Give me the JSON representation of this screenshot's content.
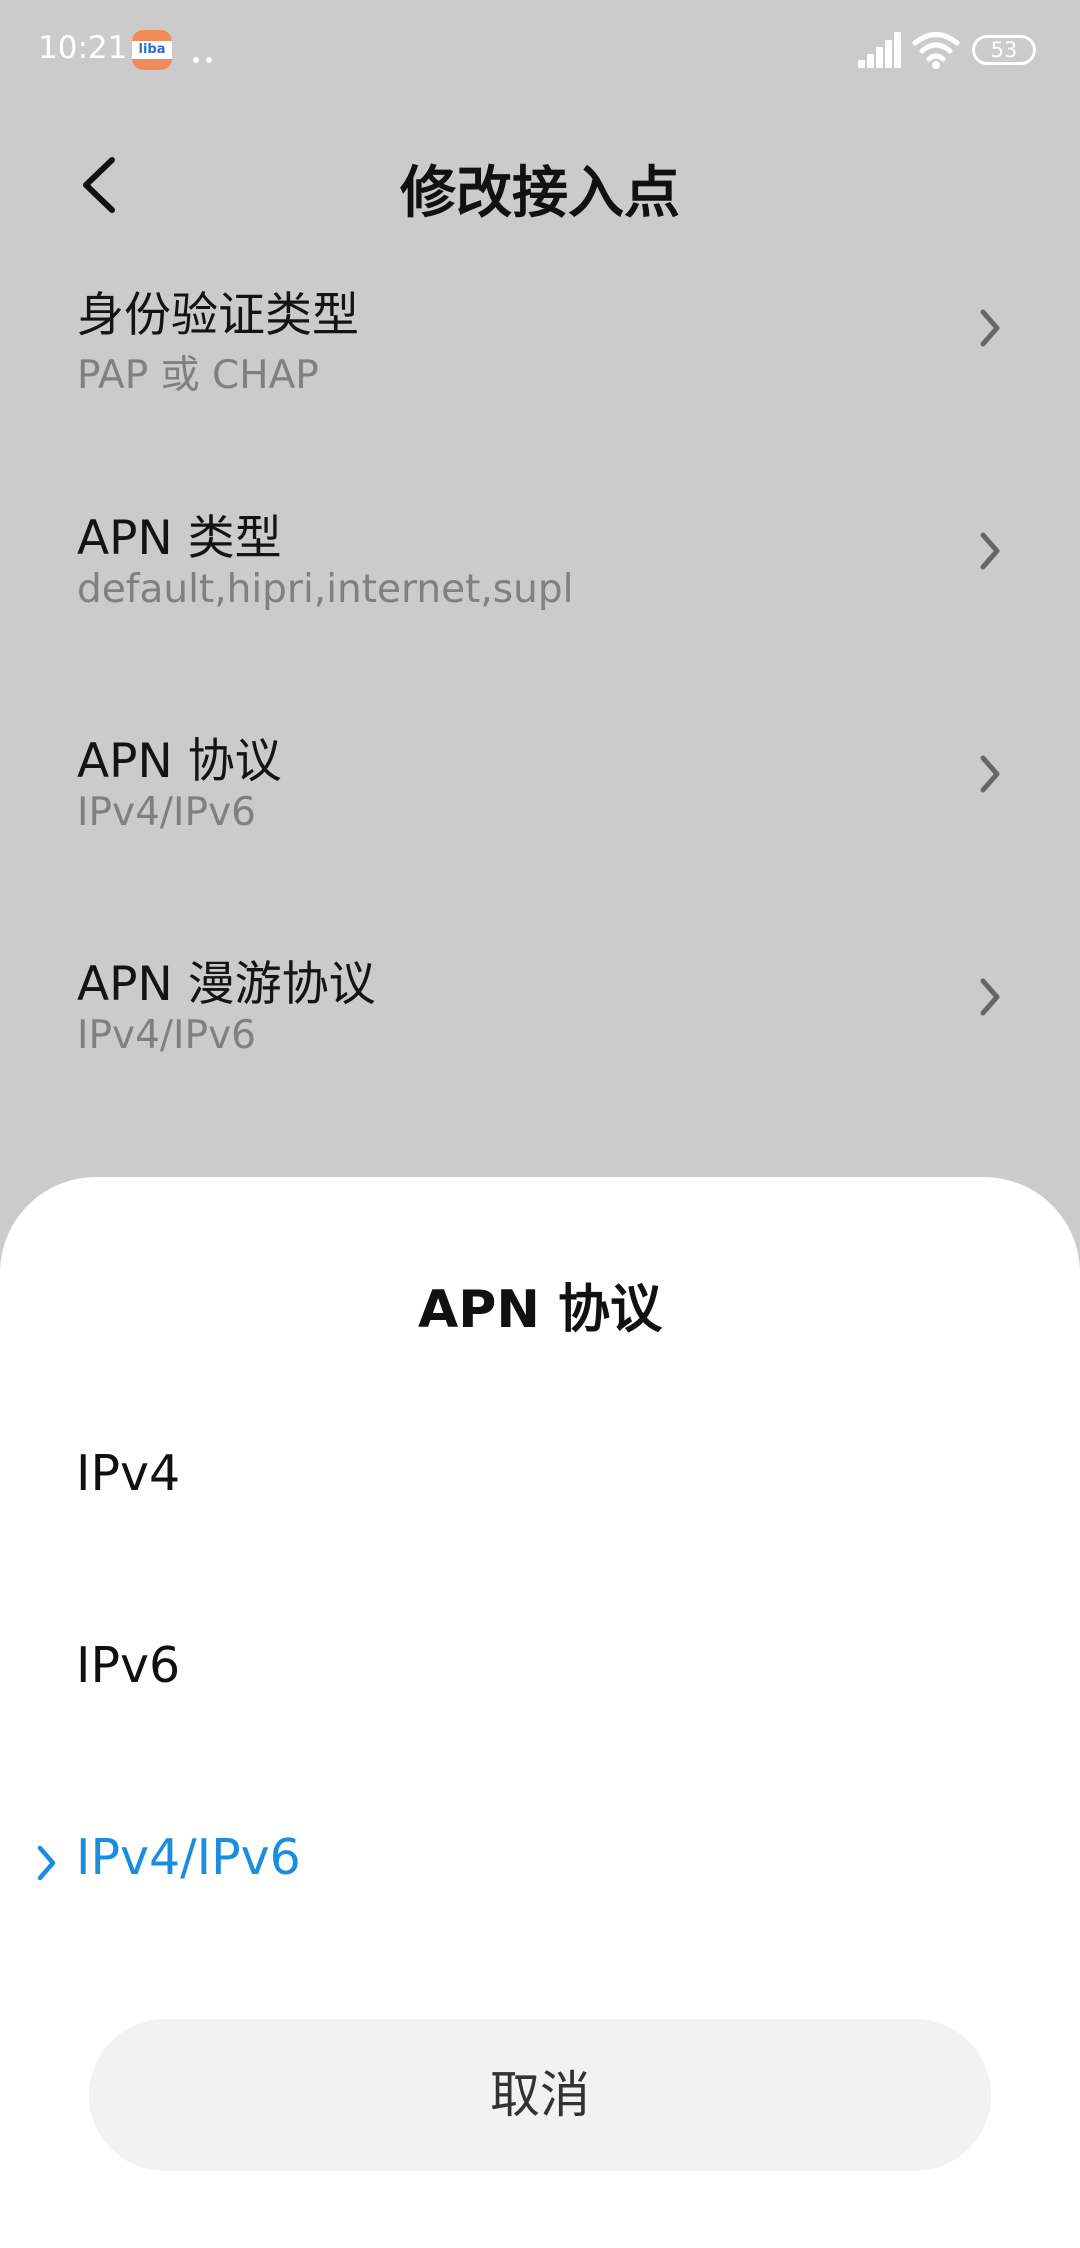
{
  "status_bar": {
    "time": "10:21",
    "app_badge_text": "liba",
    "battery_level": "53"
  },
  "header": {
    "title": "修改接入点"
  },
  "settings": [
    {
      "title": "身份验证类型",
      "value": "PAP 或 CHAP"
    },
    {
      "title": "APN 类型",
      "value": "default,hipri,internet,supl"
    },
    {
      "title": "APN 协议",
      "value": "IPv4/IPv6"
    },
    {
      "title": "APN 漫游协议",
      "value": "IPv4/IPv6"
    }
  ],
  "dialog": {
    "title": "APN 协议",
    "options": [
      {
        "label": "IPv4",
        "selected": false
      },
      {
        "label": "IPv6",
        "selected": false
      },
      {
        "label": "IPv4/IPv6",
        "selected": true
      }
    ],
    "cancel_label": "取消"
  },
  "colors": {
    "accent": "#1a8de0",
    "dim_background": "#cbcbcb",
    "sheet_background": "#ffffff"
  },
  "icons": [
    "back-arrow-icon",
    "chevron-right-icon",
    "check-chevron-icon",
    "signal-icon",
    "wifi-icon",
    "battery-icon"
  ]
}
